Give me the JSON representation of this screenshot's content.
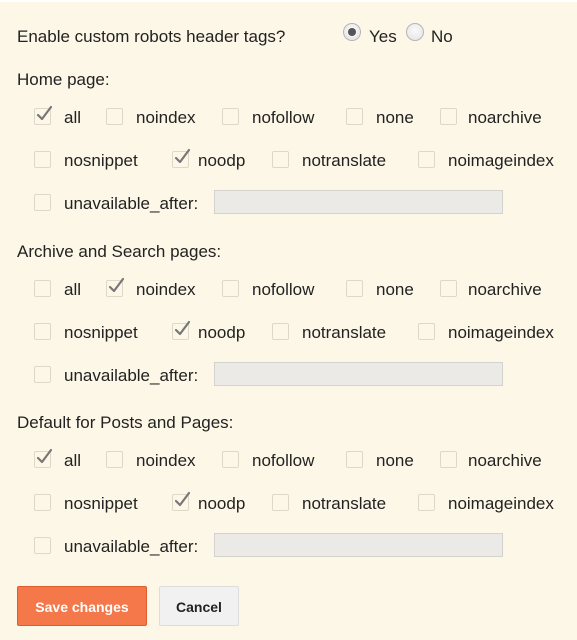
{
  "enable": {
    "label": "Enable custom robots header tags?",
    "options": [
      {
        "label": "Yes",
        "selected": true
      },
      {
        "label": "No",
        "selected": false
      }
    ]
  },
  "sections": [
    {
      "title": "Home page:",
      "row1": [
        {
          "label": "all",
          "checked": true
        },
        {
          "label": "noindex",
          "checked": false
        },
        {
          "label": "nofollow",
          "checked": false
        },
        {
          "label": "none",
          "checked": false
        },
        {
          "label": "noarchive",
          "checked": false
        }
      ],
      "row2": [
        {
          "label": "nosnippet",
          "checked": false
        },
        {
          "label": "noodp",
          "checked": true
        },
        {
          "label": "notranslate",
          "checked": false
        },
        {
          "label": "noimageindex",
          "checked": false
        }
      ],
      "unavailable": {
        "label": "unavailable_after:",
        "checked": false,
        "value": ""
      }
    },
    {
      "title": "Archive and Search pages:",
      "row1": [
        {
          "label": "all",
          "checked": false
        },
        {
          "label": "noindex",
          "checked": true
        },
        {
          "label": "nofollow",
          "checked": false
        },
        {
          "label": "none",
          "checked": false
        },
        {
          "label": "noarchive",
          "checked": false
        }
      ],
      "row2": [
        {
          "label": "nosnippet",
          "checked": false
        },
        {
          "label": "noodp",
          "checked": true
        },
        {
          "label": "notranslate",
          "checked": false
        },
        {
          "label": "noimageindex",
          "checked": false
        }
      ],
      "unavailable": {
        "label": "unavailable_after:",
        "checked": false,
        "value": ""
      }
    },
    {
      "title": "Default for Posts and Pages:",
      "row1": [
        {
          "label": "all",
          "checked": true
        },
        {
          "label": "noindex",
          "checked": false
        },
        {
          "label": "nofollow",
          "checked": false
        },
        {
          "label": "none",
          "checked": false
        },
        {
          "label": "noarchive",
          "checked": false
        }
      ],
      "row2": [
        {
          "label": "nosnippet",
          "checked": false
        },
        {
          "label": "noodp",
          "checked": true
        },
        {
          "label": "notranslate",
          "checked": false
        },
        {
          "label": "noimageindex",
          "checked": false
        }
      ],
      "unavailable": {
        "label": "unavailable_after:",
        "checked": false,
        "value": ""
      }
    }
  ],
  "buttons": {
    "save": "Save changes",
    "cancel": "Cancel"
  },
  "colors": {
    "background": "#fdf7e7",
    "save_button": "#f4784a",
    "cancel_button": "#f1f1f1",
    "checkmark": "#777777"
  }
}
